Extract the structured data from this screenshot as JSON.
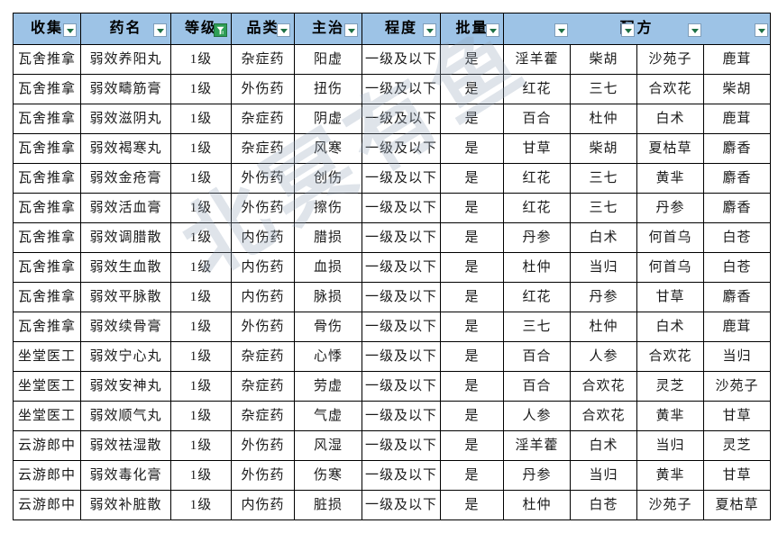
{
  "watermark": {
    "text": "北冥有鱼"
  },
  "table": {
    "headers": [
      {
        "label": "收集",
        "filter": "normal",
        "key": "collect"
      },
      {
        "label": "药名",
        "filter": "normal",
        "key": "name"
      },
      {
        "label": "等级",
        "filter": "active",
        "key": "grade"
      },
      {
        "label": "品类",
        "filter": "normal",
        "key": "category"
      },
      {
        "label": "主治",
        "filter": "normal",
        "key": "treats"
      },
      {
        "label": "程度",
        "filter": "normal",
        "key": "degree"
      },
      {
        "label": "批量",
        "filter": "normal",
        "key": "batch"
      }
    ],
    "merged_header": {
      "label": "配方",
      "colspan": 4,
      "filters": 4
    },
    "rows": [
      {
        "collect": "瓦舍推拿",
        "name": "弱效养阳丸",
        "grade": "1级",
        "category": "杂症药",
        "treats": "阳虚",
        "degree": "一级及以下",
        "batch": "是",
        "ing": [
          "淫羊藿",
          "柴胡",
          "沙苑子",
          "鹿茸"
        ]
      },
      {
        "collect": "瓦舍推拿",
        "name": "弱效疇筋膏",
        "grade": "1级",
        "category": "外伤药",
        "treats": "扭伤",
        "degree": "一级及以下",
        "batch": "是",
        "ing": [
          "红花",
          "三七",
          "合欢花",
          "柴胡"
        ]
      },
      {
        "collect": "瓦舍推拿",
        "name": "弱效滋阴丸",
        "grade": "1级",
        "category": "杂症药",
        "treats": "阴虚",
        "degree": "一级及以下",
        "batch": "是",
        "ing": [
          "百合",
          "杜仲",
          "白术",
          "鹿茸"
        ]
      },
      {
        "collect": "瓦舍推拿",
        "name": "弱效褐寒丸",
        "grade": "1级",
        "category": "杂症药",
        "treats": "风寒",
        "degree": "一级及以下",
        "batch": "是",
        "ing": [
          "甘草",
          "柴胡",
          "夏枯草",
          "麝香"
        ]
      },
      {
        "collect": "瓦舍推拿",
        "name": "弱效金疮膏",
        "grade": "1级",
        "category": "外伤药",
        "treats": "创伤",
        "degree": "一级及以下",
        "batch": "是",
        "ing": [
          "红花",
          "三七",
          "黄芈",
          "麝香"
        ]
      },
      {
        "collect": "瓦舍推拿",
        "name": "弱效活血膏",
        "grade": "1级",
        "category": "外伤药",
        "treats": "擦伤",
        "degree": "一级及以下",
        "batch": "是",
        "ing": [
          "红花",
          "三七",
          "丹参",
          "麝香"
        ]
      },
      {
        "collect": "瓦舍推拿",
        "name": "弱效调腊散",
        "grade": "1级",
        "category": "内伤药",
        "treats": "腊损",
        "degree": "一级及以下",
        "batch": "是",
        "ing": [
          "丹参",
          "白术",
          "何首乌",
          "白苍"
        ]
      },
      {
        "collect": "瓦舍推拿",
        "name": "弱效生血散",
        "grade": "1级",
        "category": "内伤药",
        "treats": "血损",
        "degree": "一级及以下",
        "batch": "是",
        "ing": [
          "杜仲",
          "当归",
          "何首乌",
          "白苍"
        ]
      },
      {
        "collect": "瓦舍推拿",
        "name": "弱效平脉散",
        "grade": "1级",
        "category": "内伤药",
        "treats": "脉损",
        "degree": "一级及以下",
        "batch": "是",
        "ing": [
          "红花",
          "丹参",
          "甘草",
          "麝香"
        ]
      },
      {
        "collect": "瓦舍推拿",
        "name": "弱效续骨膏",
        "grade": "1级",
        "category": "外伤药",
        "treats": "骨伤",
        "degree": "一级及以下",
        "batch": "是",
        "ing": [
          "三七",
          "杜仲",
          "白术",
          "鹿茸"
        ]
      },
      {
        "collect": "坐堂医工",
        "name": "弱效宁心丸",
        "grade": "1级",
        "category": "杂症药",
        "treats": "心悸",
        "degree": "一级及以下",
        "batch": "是",
        "ing": [
          "百合",
          "人参",
          "合欢花",
          "当归"
        ]
      },
      {
        "collect": "坐堂医工",
        "name": "弱效安神丸",
        "grade": "1级",
        "category": "杂症药",
        "treats": "劳虚",
        "degree": "一级及以下",
        "batch": "是",
        "ing": [
          "百合",
          "合欢花",
          "灵芝",
          "沙苑子"
        ]
      },
      {
        "collect": "坐堂医工",
        "name": "弱效顺气丸",
        "grade": "1级",
        "category": "杂症药",
        "treats": "气虚",
        "degree": "一级及以下",
        "batch": "是",
        "ing": [
          "人参",
          "合欢花",
          "黄芈",
          "甘草"
        ]
      },
      {
        "collect": "云游郎中",
        "name": "弱效祛湿散",
        "grade": "1级",
        "category": "外伤药",
        "treats": "风湿",
        "degree": "一级及以下",
        "batch": "是",
        "ing": [
          "淫羊藿",
          "白术",
          "当归",
          "灵芝"
        ]
      },
      {
        "collect": "云游郎中",
        "name": "弱效毒化膏",
        "grade": "1级",
        "category": "外伤药",
        "treats": "伤寒",
        "degree": "一级及以下",
        "batch": "是",
        "ing": [
          "丹参",
          "当归",
          "黄芈",
          "甘草"
        ]
      },
      {
        "collect": "云游郎中",
        "name": "弱效补脏散",
        "grade": "1级",
        "category": "内伤药",
        "treats": "脏损",
        "degree": "一级及以下",
        "batch": "是",
        "ing": [
          "杜仲",
          "白苍",
          "沙苑子",
          "夏枯草"
        ]
      }
    ]
  },
  "colors": {
    "header_bg": "#9DC3E6",
    "grid_line": "#000000",
    "filter_active": "#2E9E55",
    "arrow": "#1E7145"
  }
}
